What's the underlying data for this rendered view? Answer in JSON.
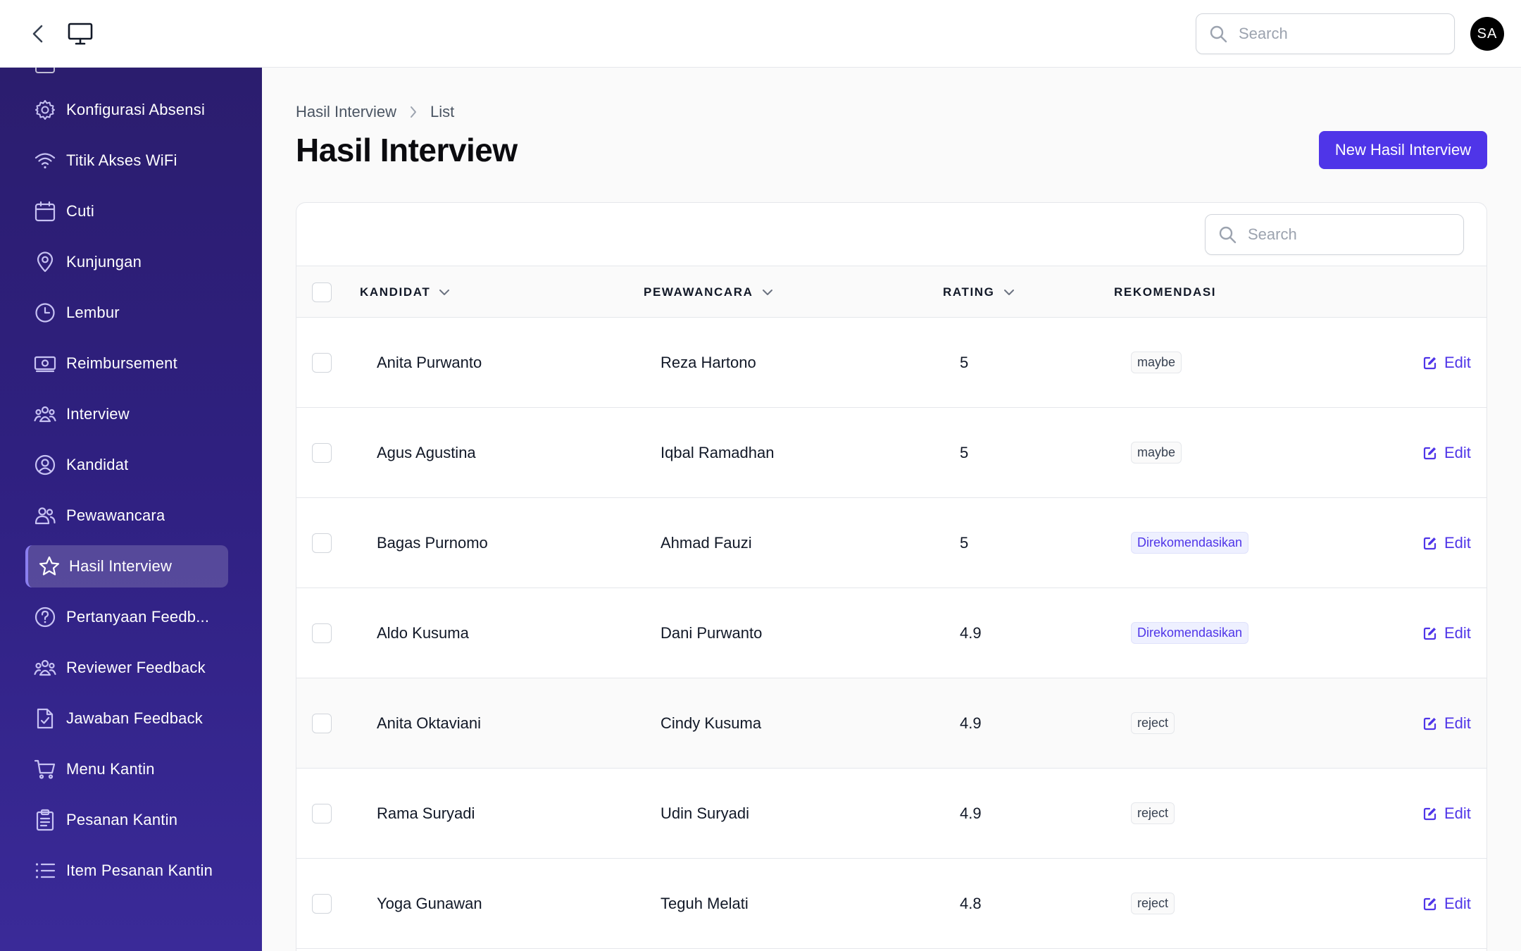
{
  "topbar": {
    "search_placeholder": "Search",
    "avatar_initials": "SA"
  },
  "sidebar": {
    "items": [
      {
        "label": "Konfigurasi Absensi",
        "icon": "gear-icon"
      },
      {
        "label": "Titik Akses WiFi",
        "icon": "wifi-icon"
      },
      {
        "label": "Cuti",
        "icon": "calendar-icon"
      },
      {
        "label": "Kunjungan",
        "icon": "map-pin-icon"
      },
      {
        "label": "Lembur",
        "icon": "clock-icon"
      },
      {
        "label": "Reimbursement",
        "icon": "cash-icon"
      },
      {
        "label": "Interview",
        "icon": "user-group-icon"
      },
      {
        "label": "Kandidat",
        "icon": "user-circle-icon"
      },
      {
        "label": "Pewawancara",
        "icon": "users-icon"
      },
      {
        "label": "Hasil Interview",
        "icon": "star-icon",
        "active": true
      },
      {
        "label": "Pertanyaan Feedb...",
        "icon": "question-circle-icon"
      },
      {
        "label": "Reviewer Feedback",
        "icon": "user-group-icon"
      },
      {
        "label": "Jawaban Feedback",
        "icon": "document-check-icon"
      },
      {
        "label": "Menu Kantin",
        "icon": "shopping-cart-icon"
      },
      {
        "label": "Pesanan Kantin",
        "icon": "clipboard-list-icon"
      },
      {
        "label": "Item Pesanan Kantin",
        "icon": "list-bullet-icon"
      }
    ]
  },
  "breadcrumb": {
    "parent": "Hasil Interview",
    "current": "List"
  },
  "page": {
    "title": "Hasil Interview",
    "new_button": "New Hasil Interview"
  },
  "table": {
    "search_placeholder": "Search",
    "columns": {
      "kandidat": "KANDIDAT",
      "pewawancara": "PEWAWANCARA",
      "rating": "RATING",
      "rekomendasi": "REKOMENDASI"
    },
    "edit_label": "Edit",
    "rows": [
      {
        "kandidat": "Anita Purwanto",
        "pewawancara": "Reza Hartono",
        "rating": "5",
        "rekomendasi": "maybe"
      },
      {
        "kandidat": "Agus Agustina",
        "pewawancara": "Iqbal Ramadhan",
        "rating": "5",
        "rekomendasi": "maybe"
      },
      {
        "kandidat": "Bagas Purnomo",
        "pewawancara": "Ahmad Fauzi",
        "rating": "5",
        "rekomendasi": "Direkomendasikan"
      },
      {
        "kandidat": "Aldo Kusuma",
        "pewawancara": "Dani Purwanto",
        "rating": "4.9",
        "rekomendasi": "Direkomendasikan"
      },
      {
        "kandidat": "Anita Oktaviani",
        "pewawancara": "Cindy Kusuma",
        "rating": "4.9",
        "rekomendasi": "reject"
      },
      {
        "kandidat": "Rama Suryadi",
        "pewawancara": "Udin Suryadi",
        "rating": "4.9",
        "rekomendasi": "reject"
      },
      {
        "kandidat": "Yoga Gunawan",
        "pewawancara": "Teguh Melati",
        "rating": "4.8",
        "rekomendasi": "reject"
      }
    ]
  },
  "colors": {
    "accent": "#4f35e8",
    "sidebar_top": "#2b1d6e",
    "sidebar_bottom": "#3a2a98"
  }
}
